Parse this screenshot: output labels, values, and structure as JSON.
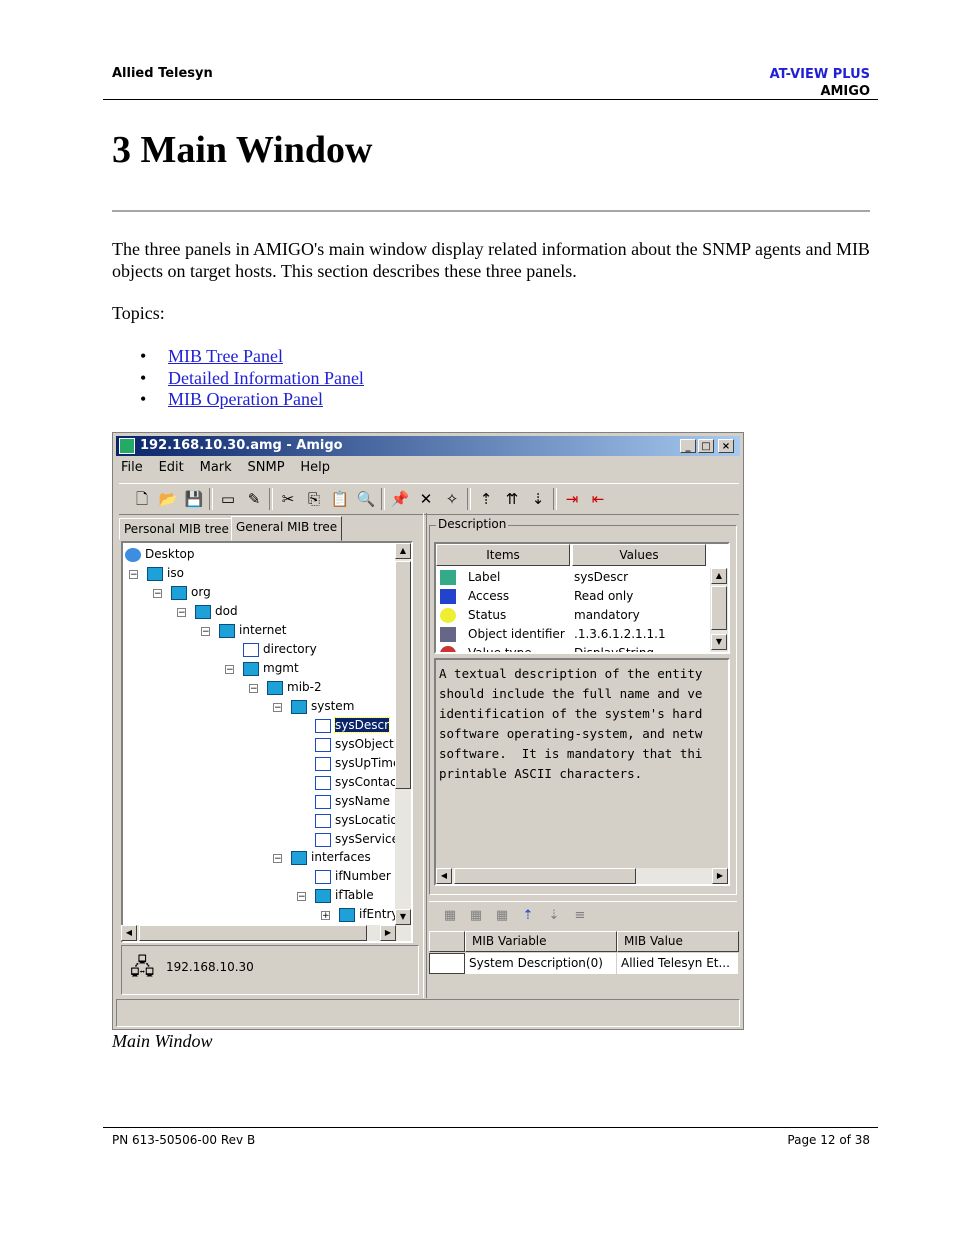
{
  "header": {
    "company": "Allied Telesyn",
    "product": "AT-VIEW PLUS",
    "module": "AMIGO"
  },
  "heading": "3 Main Window",
  "intro": "The three panels in AMIGO's main window display related information about the SNMP agents and MIB objects on target hosts. This section describes these three panels.",
  "topics_label": "Topics:",
  "topics": [
    "MIB Tree Panel",
    "Detailed Information Panel",
    "MIB Operation Panel"
  ],
  "window": {
    "title": "192.168.10.30.amg - Amigo",
    "menu": [
      "File",
      "Edit",
      "Mark",
      "SNMP",
      "Help"
    ],
    "tabs": [
      "Personal MIB tree",
      "General MIB tree"
    ],
    "tree": [
      {
        "label": "Desktop",
        "icon": "globe-icon"
      },
      {
        "label": "iso",
        "icon": "folder-cube-icon"
      },
      {
        "label": "org",
        "icon": "folder-cube-icon"
      },
      {
        "label": "dod",
        "icon": "folder-cube-icon"
      },
      {
        "label": "internet",
        "icon": "folder-cube-icon"
      },
      {
        "label": "directory",
        "icon": "mib-leaf-icon"
      },
      {
        "label": "mgmt",
        "icon": "folder-cube-icon"
      },
      {
        "label": "mib-2",
        "icon": "folder-cube-icon"
      },
      {
        "label": "system",
        "icon": "folder-cube-icon"
      },
      {
        "label": "sysDescr",
        "icon": "mib-leaf-icon"
      },
      {
        "label": "sysObjectII",
        "icon": "mib-leaf-icon"
      },
      {
        "label": "sysUpTime",
        "icon": "mib-leaf-icon"
      },
      {
        "label": "sysContact",
        "icon": "mib-leaf-icon"
      },
      {
        "label": "sysName",
        "icon": "mib-leaf-icon"
      },
      {
        "label": "sysLocatio",
        "icon": "mib-leaf-icon"
      },
      {
        "label": "sysService",
        "icon": "mib-leaf-icon"
      },
      {
        "label": "interfaces",
        "icon": "folder-cube-icon"
      },
      {
        "label": "ifNumber",
        "icon": "mib-leaf-icon"
      },
      {
        "label": "ifTable",
        "icon": "folder-cube-icon"
      },
      {
        "label": "ifEntry",
        "icon": "folder-cube-icon"
      }
    ],
    "selected_node": "sysDescr",
    "host": "192.168.10.30",
    "description_group": "Description",
    "grid_headers": [
      "Items",
      "Values"
    ],
    "grid_rows": [
      {
        "item": "Label",
        "value": "sysDescr"
      },
      {
        "item": "Access",
        "value": "Read only"
      },
      {
        "item": "Status",
        "value": "mandatory"
      },
      {
        "item": "Object identifier",
        "value": ".1.3.6.1.2.1.1.1"
      },
      {
        "item": "Value type",
        "value": "DisplayString"
      }
    ],
    "description_text": "A textual description of the entity\nshould include the full name and ve\nidentification of the system's hard\nsoftware operating-system, and netw\nsoftware.  It is mandatory that thi\nprintable ASCII characters.",
    "op_headers": [
      "MIB Variable",
      "MIB Value"
    ],
    "op_row": {
      "variable": "System Description(0)",
      "value": "Allied Telesyn Et..."
    }
  },
  "caption": "Main Window",
  "footer": {
    "part_number": "PN 613-50506-00 Rev B",
    "page": "Page 12 of 38"
  }
}
